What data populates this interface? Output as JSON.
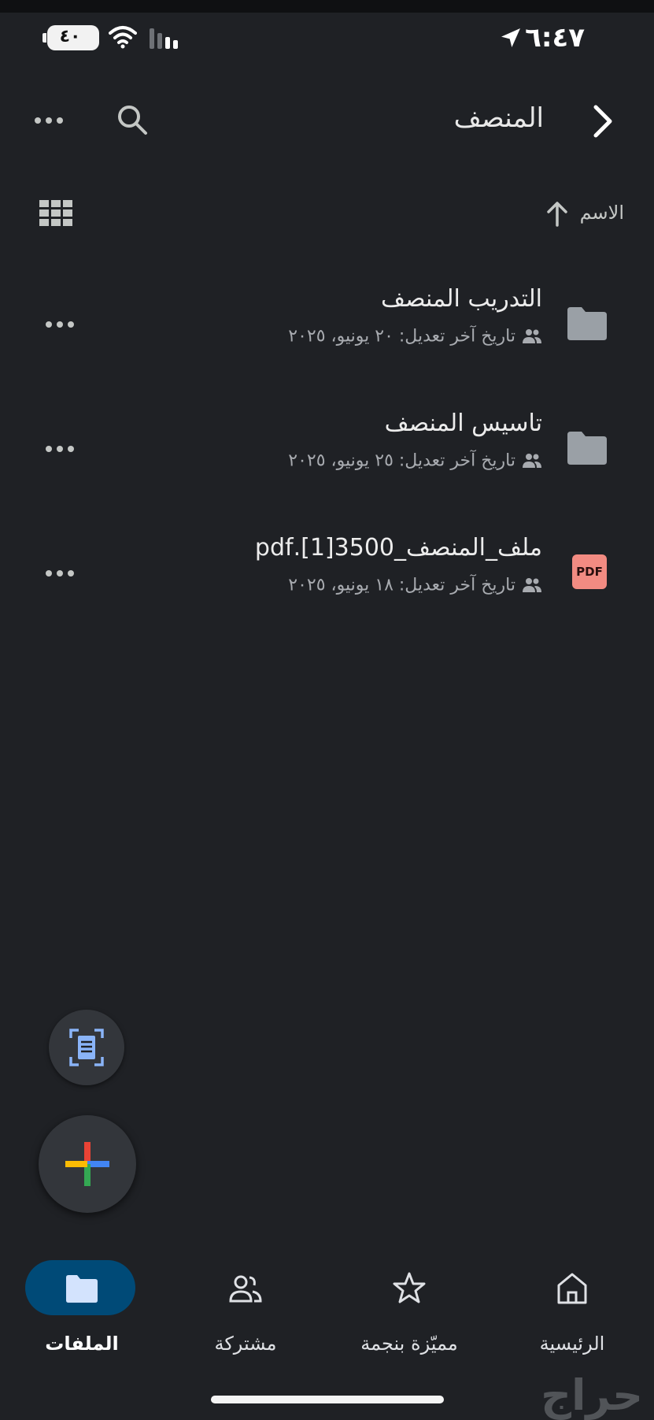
{
  "status_bar": {
    "time": "٦:٤٧",
    "battery": "٤٠"
  },
  "header": {
    "title": "المنصف"
  },
  "sort": {
    "label": "الاسم"
  },
  "files": [
    {
      "name": "التدريب المنصف",
      "meta": "تاريخ آخر تعديل: ٢٠ يونيو، ٢٠٢٥",
      "type": "folder"
    },
    {
      "name": "تاسيس المنصف",
      "meta": "تاريخ آخر تعديل: ٢٥ يونيو، ٢٠٢٥",
      "type": "folder"
    },
    {
      "name": "ملف_المنصف_3500[1].pdf",
      "meta": "تاريخ آخر تعديل: ١٨ يونيو، ٢٠٢٥",
      "type": "pdf",
      "badge": "PDF"
    }
  ],
  "nav": {
    "files": "الملفات",
    "shared": "مشتركة",
    "starred": "مميّزة بنجمة",
    "home": "الرئيسية"
  },
  "watermark": "حراج",
  "colors": {
    "accent_pill": "#004a77",
    "pdf": "#f28b82",
    "background": "#1f2125"
  }
}
